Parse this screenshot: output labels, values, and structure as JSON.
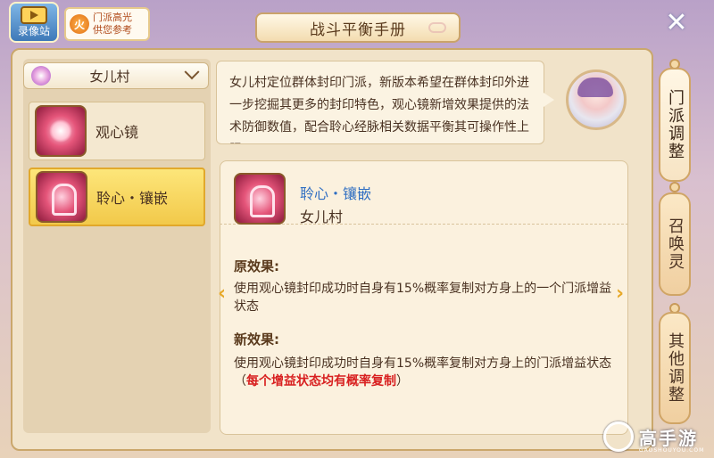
{
  "top": {
    "record_label": "录像站",
    "highlight_tip": [
      "门派高光",
      "供您参考"
    ],
    "tip_icon_glyph": "火"
  },
  "title": "战斗平衡手册",
  "close_glyph": "✕",
  "sidebar": {
    "village": "女儿村",
    "items": [
      {
        "label": "观心镜",
        "icon": "mirror-icon",
        "selected": false
      },
      {
        "label": "聆心・镶嵌",
        "icon": "lyre-icon",
        "selected": true
      }
    ]
  },
  "description": "女儿村定位群体封印门派，新版本希望在群体封印外进一步挖掘其更多的封印特色，观心镜新增效果提供的法术防御数值，配合聆心经脉相关数据平衡其可操作性上限",
  "detail": {
    "skill_name": "聆心・镶嵌",
    "village": "女儿村",
    "old_title": "原效果:",
    "old_text": "使用观心镜封印成功时自身有15%概率复制对方身上的一个门派增益状态",
    "new_title": "新效果:",
    "new_text_main": "使用观心镜封印成功时自身有15%概率复制对方身上的门派增益状态（",
    "new_text_highlight": "每个增益状态均有概率复制",
    "new_text_end": "）"
  },
  "arrows": {
    "left": "‹",
    "right": "›"
  },
  "tabs": [
    {
      "label": "门派调整",
      "active": true
    },
    {
      "label": "召唤灵",
      "active": false
    },
    {
      "label": "其他调整",
      "active": false
    }
  ],
  "watermark": {
    "text": "高手游",
    "sub": "GAOSHOUYOU.COM"
  },
  "colors": {
    "highlight_red": "#d82020",
    "skill_name_blue": "#2f6ec2",
    "selected_item": "#f2c94a"
  }
}
